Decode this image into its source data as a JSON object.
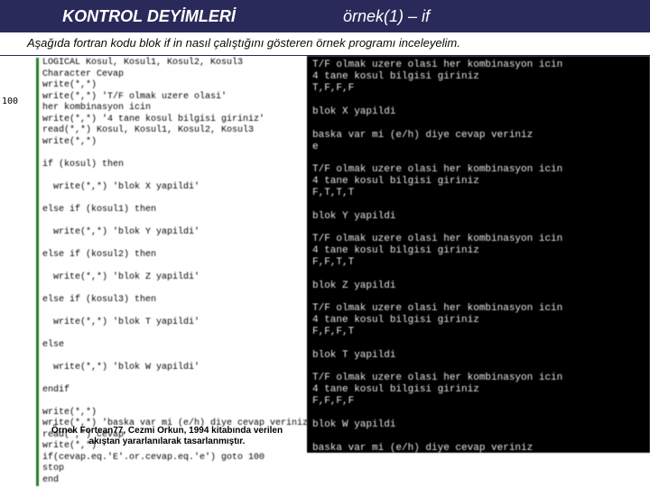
{
  "header": {
    "title": "KONTROL DEYİMLERİ",
    "subtitle": "örnek(1) – if"
  },
  "subhead": "Aşağıda fortran kodu blok if in nasıl çalıştığını gösteren örnek programı inceleyelim.",
  "code": {
    "label": "100",
    "text": "LOGICAL Kosul, Kosul1, Kosul2, Kosul3\nCharacter Cevap\nwrite(*,*)\nwrite(*,*) 'T/F olmak uzere olasi'\nher kombinasyon icin\nwrite(*,*) '4 tane kosul bilgisi giriniz'\nread(*,*) Kosul, Kosul1, Kosul2, Kosul3\nwrite(*,*)\n\nif (kosul) then\n\n  write(*,*) 'blok X yapildi'\n\nelse if (kosul1) then\n\n  write(*,*) 'blok Y yapildi'\n\nelse if (kosul2) then\n\n  write(*,*) 'blok Z yapildi'\n\nelse if (kosul3) then\n\n  write(*,*) 'blok T yapildi'\n\nelse\n\n  write(*,*) 'blok W yapildi'\n\nendif\n\nwrite(*,*)\nwrite(*,*) 'baska var mi (e/h) diye cevap veriniz'\nread(*,*) cevap\nwrite(*,*)\nif(cevap.eq.'E'.or.cevap.eq.'e') goto 100\nstop\nend"
  },
  "runs": {
    "r1": "T/F olmak uzere olasi her kombinasyon icin\n4 tane kosul bilgisi giriniz\nT,F,F,F\n\nblok X yapildi\n\nbaska var mi (e/h) diye cevap veriniz\ne",
    "r2": "T/F olmak uzere olasi her kombinasyon icin\n4 tane kosul bilgisi giriniz\nF,T,T,T\n\nblok Y yapildi",
    "r3": "T/F olmak uzere olasi her kombinasyon icin\n4 tane kosul bilgisi giriniz\nF,F,T,T\n\nblok Z yapildi",
    "r4": "T/F olmak uzere olasi her kombinasyon icin\n4 tane kosul bilgisi giriniz\nF,F,F,T\n\nblok T yapildi",
    "r5": "T/F olmak uzere olasi her kombinasyon icin\n4 tane kosul bilgisi giriniz\nF,F,F,F\n\nblok W yapildi\n\nbaska var mi (e/h) diye cevap veriniz"
  },
  "footnote": "Örnek Fortean77, Cezmi Orkun, 1994 kitabında verilen akıştan yararlanılarak tasarlanmıştır."
}
